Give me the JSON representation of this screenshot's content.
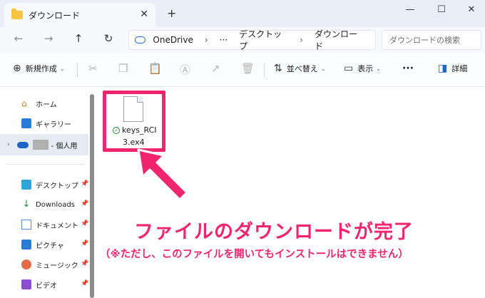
{
  "window": {
    "tab_title": "ダウンロード",
    "tab_close": "✕",
    "new_tab": "+",
    "minimize": "—",
    "maximize": "☐",
    "close": "✕"
  },
  "address_bar": {
    "parts": [
      "OneDrive",
      "›",
      "···",
      "デスクトップ",
      "›",
      "ダウンロード"
    ],
    "search_placeholder": "ダウンロードの検索"
  },
  "toolbar": {
    "new_label": "新規作成",
    "sort_label": "並べ替え",
    "view_label": "表示",
    "more_label": "···",
    "details_label": "詳細"
  },
  "sidebar": {
    "items": [
      {
        "label": "ホーム"
      },
      {
        "label": "ギャラリー"
      },
      {
        "label": "- 個人用"
      },
      {
        "label": "デスクトップ"
      },
      {
        "label": "Downloads"
      },
      {
        "label": "ドキュメント"
      },
      {
        "label": "ピクチャ"
      },
      {
        "label": "ミュージック"
      },
      {
        "label": "ビデオ"
      }
    ]
  },
  "file": {
    "name_line1": "keys_RCI",
    "name_line2": "3.ex4"
  },
  "annotation": {
    "headline": "ファイルのダウンロードが完了",
    "subline": "（※ただし、このファイルを開いてもインストールはできません）"
  },
  "colors": {
    "accent": "#f0256e",
    "sync_ok": "#1f8a3a",
    "onedrive": "#1e63c6"
  }
}
